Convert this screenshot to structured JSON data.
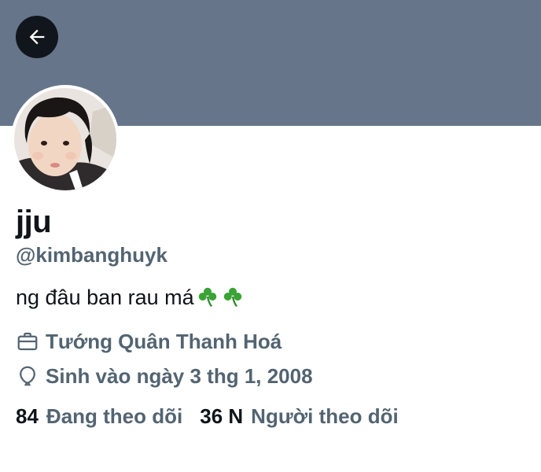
{
  "header": {
    "back_icon": "arrow-left-icon",
    "banner_color": "#66758a"
  },
  "profile": {
    "display_name": "jju",
    "handle": "@kimbanghuyk",
    "bio_text": "ng đâu ban rau má",
    "bio_emojis": [
      "shamrock",
      "shamrock"
    ],
    "location_icon": "briefcase-icon",
    "location": "Tướng Quân Thanh Hoá",
    "birth_icon": "balloon-icon",
    "birth": "Sinh vào ngày 3 thg 1, 2008"
  },
  "stats": {
    "following_count": "84",
    "following_label": "Đang theo dõi",
    "followers_count": "36 N",
    "followers_label": "Người theo dõi"
  },
  "colors": {
    "primary_text": "#0f1419",
    "secondary_text": "#536471",
    "back_button_bg": "#11161c",
    "clover_green": "#3aa335"
  }
}
